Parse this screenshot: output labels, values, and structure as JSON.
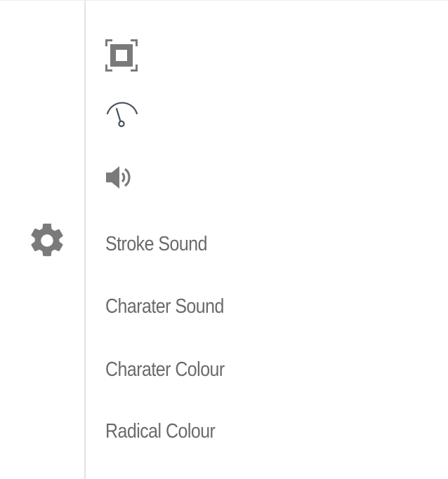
{
  "settings": {
    "gear_icon": "gear-icon",
    "icon_color": "#7a7a7a",
    "dial_color": "#4a5160"
  },
  "menu": {
    "icons": [
      "fullscreen-icon",
      "speed-dial-icon",
      "volume-icon"
    ],
    "items": [
      {
        "label": "Stroke Sound"
      },
      {
        "label": "Charater Sound"
      },
      {
        "label": "Charater Colour"
      },
      {
        "label": "Radical Colour"
      }
    ]
  }
}
